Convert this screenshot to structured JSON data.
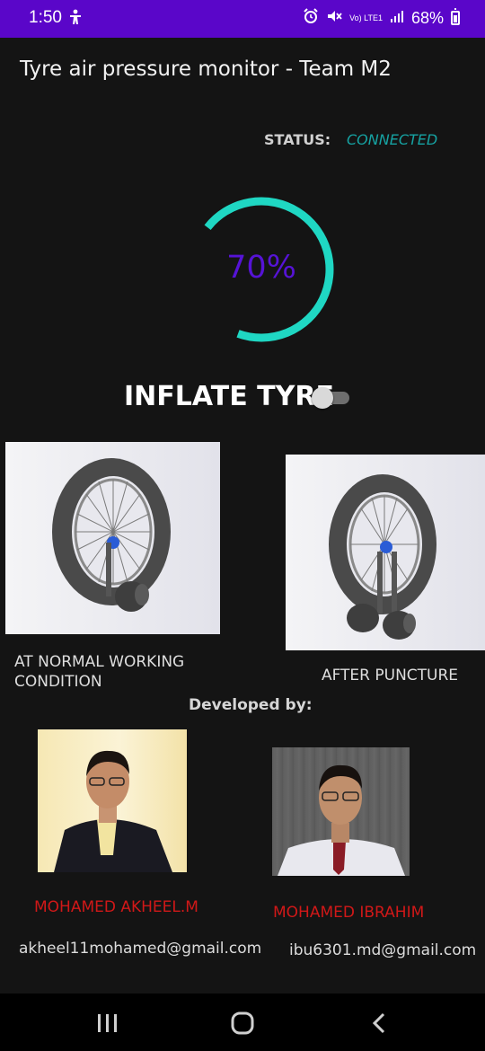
{
  "status_bar": {
    "time": "1:50",
    "battery": "68%",
    "lte_label": "Vo) LTE1",
    "background": "#5a06c9"
  },
  "app": {
    "title": "Tyre air pressure monitor - Team M2"
  },
  "connection": {
    "label": "STATUS:",
    "value": "CONNECTED",
    "value_color": "#16a3a3"
  },
  "gauge": {
    "text": "70%",
    "value": 0.7,
    "arc_color": "#1fd7c3",
    "text_color": "#5613d6"
  },
  "inflate": {
    "label": "INFLATE TYRE",
    "toggle_on": false
  },
  "images": {
    "normal_caption": "AT NORMAL WORKING CONDITION",
    "puncture_caption": "AFTER PUNCTURE"
  },
  "developers": {
    "heading": "Developed by:",
    "people": [
      {
        "name": "MOHAMED AKHEEL.M",
        "email": "akheel11mohamed@gmail.com"
      },
      {
        "name": "MOHAMED IBRAHIM",
        "email": "ibu6301.md@gmail.com"
      }
    ],
    "name_color": "#d11818"
  },
  "navigation": {
    "recent_icon": "recent-apps-icon",
    "home_icon": "home-icon",
    "back_icon": "back-icon"
  }
}
